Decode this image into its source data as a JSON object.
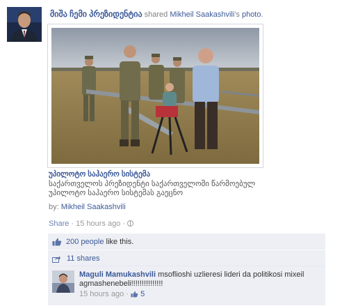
{
  "post": {
    "author": "მიშა ჩემი პრეზიდენტია",
    "action_text": "shared",
    "original_author": "Mikheil Saakashvili",
    "object_suffix": "'s ",
    "object_link": "photo",
    "period": "."
  },
  "link": {
    "title": "უპილოტო საჰაერო სისტემა",
    "description": "საქართველოს პრეზიდენტი საქართველოში წარმოებულ უპილოტო საჰაერო სისტემას გაეცნო",
    "by_label": "by:",
    "by_name": "Mikheil Saakashvili"
  },
  "actions": {
    "share_label": "Share",
    "separator": " · ",
    "timestamp": "15 hours ago",
    "separator2": " · "
  },
  "likes": {
    "count_text": "200 people",
    "suffix": " like this."
  },
  "shares": {
    "text": "11 shares"
  },
  "comment": {
    "author": "Maguli Mamukashvili",
    "text": " msoflioshi uzlieresi lideri da politikosi mixeil agmashenebeli!!!!!!!!!!!!!!!",
    "timestamp": "15 hours ago",
    "separator": " · ",
    "like_count": "5"
  },
  "colors": {
    "link": "#3b5998",
    "ufi_bg": "#edeff4",
    "meta": "#999999"
  },
  "icons": {
    "like": "thumbs-up-icon",
    "share": "share-icon",
    "privacy": "globe-icon"
  }
}
